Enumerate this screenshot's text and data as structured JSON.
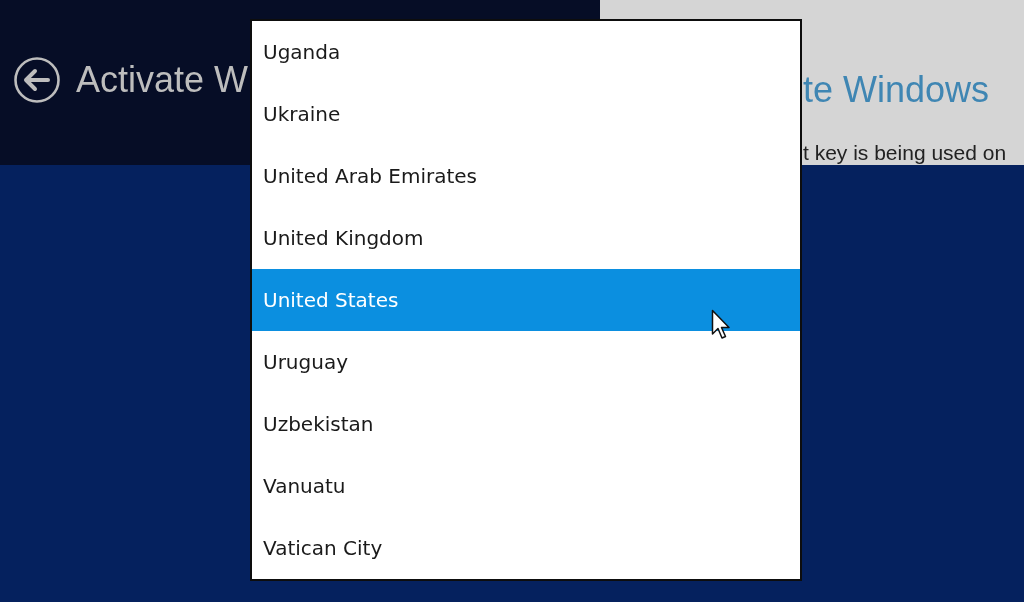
{
  "page_header": {
    "title": "Activate W"
  },
  "background_panel": {
    "title": "te Windows",
    "text": "t key is being used on"
  },
  "country_list": {
    "items": [
      {
        "label": "Uganda",
        "selected": false
      },
      {
        "label": "Ukraine",
        "selected": false
      },
      {
        "label": "United Arab Emirates",
        "selected": false
      },
      {
        "label": "United Kingdom",
        "selected": false
      },
      {
        "label": "United States",
        "selected": true
      },
      {
        "label": "Uruguay",
        "selected": false
      },
      {
        "label": "Uzbekistan",
        "selected": false
      },
      {
        "label": "Vanuatu",
        "selected": false
      },
      {
        "label": "Vatican City",
        "selected": false
      }
    ]
  }
}
